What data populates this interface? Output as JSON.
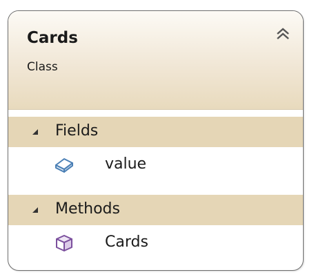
{
  "class_shape": {
    "name": "Cards",
    "kind": "Class"
  },
  "sections": {
    "fields": {
      "label": "Fields",
      "expanded": true,
      "items": [
        {
          "label": "value",
          "icon": "field-icon"
        }
      ]
    },
    "methods": {
      "label": "Methods",
      "expanded": true,
      "items": [
        {
          "label": "Cards",
          "icon": "method-icon"
        }
      ]
    }
  },
  "colors": {
    "header_gradient_top": "#fcfaf5",
    "header_gradient_bottom": "#e8dabd",
    "section_band": "#e5d6b6",
    "field_icon": "#4a7fb5",
    "method_icon": "#7b4f9d",
    "border": "#6e6e6e"
  }
}
